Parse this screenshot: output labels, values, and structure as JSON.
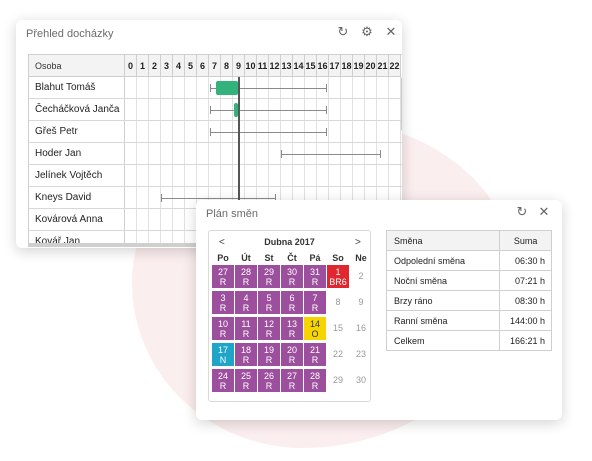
{
  "attendance": {
    "title": "Přehled docházky",
    "name_header": "Osoba",
    "hours": [
      "0",
      "1",
      "2",
      "3",
      "4",
      "5",
      "6",
      "7",
      "8",
      "9",
      "10",
      "11",
      "12",
      "13",
      "14",
      "15",
      "16",
      "17",
      "18",
      "19",
      "20",
      "21",
      "22"
    ],
    "people": [
      "Blahut Tomáš",
      "Čecháčková Janča",
      "Gřeš Petr",
      "Hoder Jan",
      "Jelínek Vojtěch",
      "Kneys David",
      "Kovárová Anna",
      "Kovář Jan"
    ]
  },
  "plan": {
    "title": "Plán směn",
    "month": "Dubna 2017",
    "prev": "<",
    "next": ">",
    "weekdays": [
      "Po",
      "Út",
      "St",
      "Čt",
      "Pá",
      "So",
      "Ne"
    ],
    "weeks": [
      [
        {
          "d": "27",
          "t": "R",
          "c": "purple"
        },
        {
          "d": "28",
          "t": "R",
          "c": "purple"
        },
        {
          "d": "29",
          "t": "R",
          "c": "purple"
        },
        {
          "d": "30",
          "t": "R",
          "c": "purple"
        },
        {
          "d": "31",
          "t": "R",
          "c": "purple"
        },
        {
          "d": "1",
          "t": "BR6",
          "c": "red"
        },
        {
          "d": "2",
          "t": "",
          "c": "none"
        }
      ],
      [
        {
          "d": "3",
          "t": "R",
          "c": "purple"
        },
        {
          "d": "4",
          "t": "R",
          "c": "purple"
        },
        {
          "d": "5",
          "t": "R",
          "c": "purple"
        },
        {
          "d": "6",
          "t": "R",
          "c": "purple"
        },
        {
          "d": "7",
          "t": "R",
          "c": "purple"
        },
        {
          "d": "8",
          "t": "",
          "c": "none"
        },
        {
          "d": "9",
          "t": "",
          "c": "none"
        }
      ],
      [
        {
          "d": "10",
          "t": "R",
          "c": "purple"
        },
        {
          "d": "11",
          "t": "R",
          "c": "purple"
        },
        {
          "d": "12",
          "t": "R",
          "c": "purple"
        },
        {
          "d": "13",
          "t": "R",
          "c": "purple"
        },
        {
          "d": "14",
          "t": "O",
          "c": "yellow"
        },
        {
          "d": "15",
          "t": "",
          "c": "none"
        },
        {
          "d": "16",
          "t": "",
          "c": "none"
        }
      ],
      [
        {
          "d": "17",
          "t": "N",
          "c": "teal"
        },
        {
          "d": "18",
          "t": "R",
          "c": "purple"
        },
        {
          "d": "19",
          "t": "R",
          "c": "purple"
        },
        {
          "d": "20",
          "t": "R",
          "c": "purple"
        },
        {
          "d": "21",
          "t": "R",
          "c": "purple"
        },
        {
          "d": "22",
          "t": "",
          "c": "none"
        },
        {
          "d": "23",
          "t": "",
          "c": "none"
        }
      ],
      [
        {
          "d": "24",
          "t": "R",
          "c": "purple"
        },
        {
          "d": "25",
          "t": "R",
          "c": "purple"
        },
        {
          "d": "26",
          "t": "R",
          "c": "purple"
        },
        {
          "d": "27",
          "t": "R",
          "c": "purple"
        },
        {
          "d": "28",
          "t": "R",
          "c": "purple"
        },
        {
          "d": "29",
          "t": "",
          "c": "none"
        },
        {
          "d": "30",
          "t": "",
          "c": "none"
        }
      ]
    ],
    "summary_headers": [
      "Směna",
      "Suma"
    ],
    "summary": [
      [
        "Odpolední směna",
        "06:30 h"
      ],
      [
        "Noční směna",
        "07:21 h"
      ],
      [
        "Brzy ráno",
        "08:30 h"
      ],
      [
        "Ranní směna",
        "144:00 h"
      ],
      [
        "Celkem",
        "166:21 h"
      ]
    ]
  },
  "colors": {
    "purple": "#9c4f9c",
    "red": "#e0262e",
    "yellow": "#f6d400",
    "teal": "#1ea5c8",
    "green": "#33b27c"
  },
  "icons": [
    "refresh-icon",
    "gear-icon",
    "close-icon"
  ]
}
